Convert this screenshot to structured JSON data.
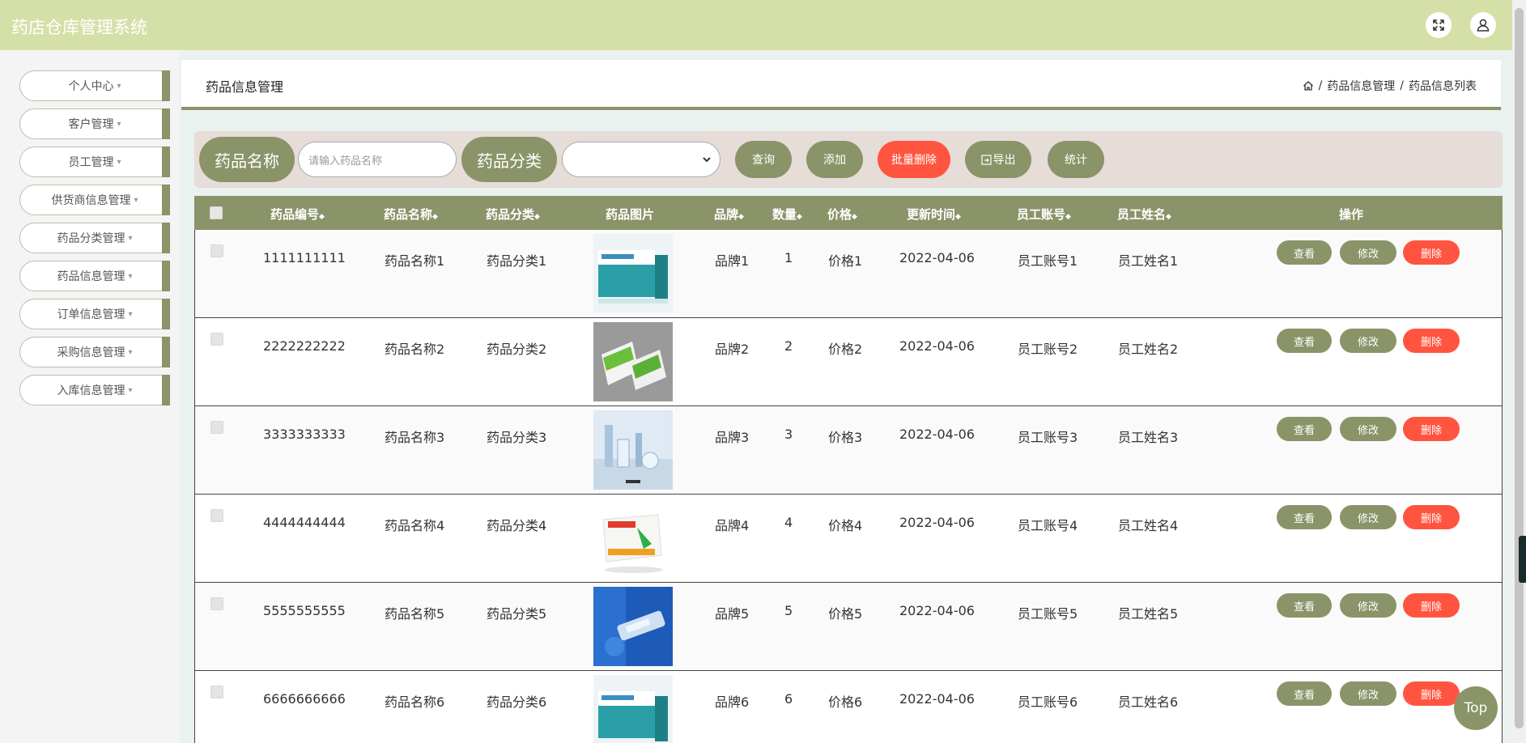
{
  "header": {
    "title": "药店仓库管理系统",
    "fullscreen_icon": "expand-icon",
    "user_icon": "user-icon"
  },
  "sidebar": {
    "items": [
      {
        "label": "个人中心"
      },
      {
        "label": "客户管理"
      },
      {
        "label": "员工管理"
      },
      {
        "label": "供货商信息管理"
      },
      {
        "label": "药品分类管理"
      },
      {
        "label": "药品信息管理"
      },
      {
        "label": "订单信息管理"
      },
      {
        "label": "采购信息管理"
      },
      {
        "label": "入库信息管理"
      }
    ],
    "caret": "▾"
  },
  "page": {
    "title": "药品信息管理",
    "breadcrumb": {
      "home_icon": "home-icon",
      "sep1": "/",
      "level1": "药品信息管理",
      "sep2": "/",
      "level2": "药品信息列表"
    }
  },
  "search": {
    "name_label": "药品名称",
    "name_placeholder": "请输入药品名称",
    "category_label": "药品分类",
    "category_value": "",
    "buttons": {
      "query": "查询",
      "add": "添加",
      "batch_delete": "批量删除",
      "export": "导出",
      "stats": "统计"
    }
  },
  "table": {
    "headers": {
      "code": "药品编号",
      "name": "药品名称",
      "category": "药品分类",
      "image": "药品图片",
      "brand": "品牌",
      "qty": "数量",
      "price": "价格",
      "updated": "更新时间",
      "emp_acct": "员工账号",
      "emp_name": "员工姓名",
      "actions": "操作"
    },
    "sort_icon": "◆",
    "action_labels": {
      "view": "查看",
      "edit": "修改",
      "delete": "删除"
    },
    "rows": [
      {
        "code": "1111111111",
        "name": "药品名称1",
        "category": "药品分类1",
        "brand": "品牌1",
        "qty": "1",
        "price": "价格1",
        "updated": "2022-04-06",
        "emp_acct": "员工账号1",
        "emp_name": "员工姓名1"
      },
      {
        "code": "2222222222",
        "name": "药品名称2",
        "category": "药品分类2",
        "brand": "品牌2",
        "qty": "2",
        "price": "价格2",
        "updated": "2022-04-06",
        "emp_acct": "员工账号2",
        "emp_name": "员工姓名2"
      },
      {
        "code": "3333333333",
        "name": "药品名称3",
        "category": "药品分类3",
        "brand": "品牌3",
        "qty": "3",
        "price": "价格3",
        "updated": "2022-04-06",
        "emp_acct": "员工账号3",
        "emp_name": "员工姓名3"
      },
      {
        "code": "4444444444",
        "name": "药品名称4",
        "category": "药品分类4",
        "brand": "品牌4",
        "qty": "4",
        "price": "价格4",
        "updated": "2022-04-06",
        "emp_acct": "员工账号4",
        "emp_name": "员工姓名4"
      },
      {
        "code": "5555555555",
        "name": "药品名称5",
        "category": "药品分类5",
        "brand": "品牌5",
        "qty": "5",
        "price": "价格5",
        "updated": "2022-04-06",
        "emp_acct": "员工账号5",
        "emp_name": "员工姓名5"
      },
      {
        "code": "6666666666",
        "name": "药品名称6",
        "category": "药品分类6",
        "brand": "品牌6",
        "qty": "6",
        "price": "价格6",
        "updated": "2022-04-06",
        "emp_acct": "员工账号6",
        "emp_name": "员工姓名6"
      }
    ]
  },
  "back_to_top": "Top",
  "colors": {
    "accent": "#8a9468",
    "header": "#d5e0a8",
    "danger": "#ff5540",
    "search_bg": "#e6dcd8"
  }
}
